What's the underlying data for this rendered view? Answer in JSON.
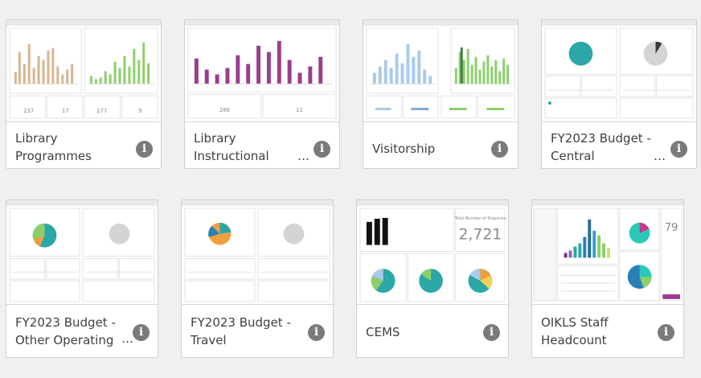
{
  "colors": {
    "page_bg": "#f0f0f0",
    "card_border": "#d0d0d0",
    "title_text": "#404040",
    "info_icon": "#7a7a7a",
    "tan": "#d8b48f",
    "green": "#8ccf6a",
    "purple": "#9b3d8e",
    "light_blue": "#a9cbea",
    "teal": "#2aa7a6"
  },
  "apps": [
    {
      "title_line1": "Library",
      "title_line2": "Programmes",
      "truncated": false,
      "icon": "info-icon"
    },
    {
      "title_line1": "Library",
      "title_line2": "Instructional",
      "truncated": true,
      "icon": "info-icon"
    },
    {
      "title_line1": "Visitorship",
      "title_line2": "",
      "truncated": false,
      "icon": "info-icon"
    },
    {
      "title_line1": "FY2023 Budget -",
      "title_line2": "Central",
      "truncated": true,
      "icon": "info-icon"
    },
    {
      "title_line1": "FY2023 Budget -",
      "title_line2": "Other Operating",
      "truncated": true,
      "icon": "info-icon"
    },
    {
      "title_line1": "FY2023 Budget -",
      "title_line2": "Travel",
      "truncated": false,
      "icon": "info-icon"
    },
    {
      "title_line1": "CEMS",
      "title_line2": "",
      "truncated": false,
      "icon": "info-icon"
    },
    {
      "title_line1": "OIKLS Staff",
      "title_line2": "Headcount",
      "truncated": false,
      "icon": "info-icon"
    }
  ],
  "thumb_text": {
    "cems_kpi_label": "Total Number of Enquiries",
    "cems_kpi_value": "2,721",
    "staff_kpi_value": "79",
    "prog_kpi_a": "237",
    "prog_kpi_b": "17",
    "prog_kpi_c": "177",
    "prog_kpi_d": "9",
    "instr_kpi_a": "286",
    "instr_kpi_b": "11"
  },
  "ellipsis": "…",
  "info_glyph": "i"
}
